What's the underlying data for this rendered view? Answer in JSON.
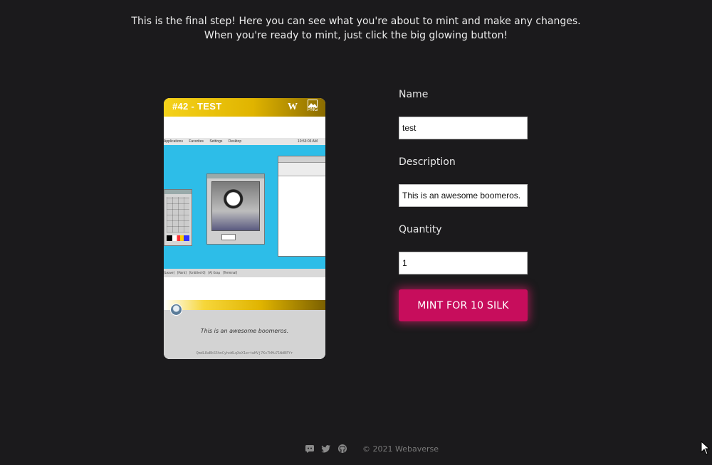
{
  "intro": {
    "line1": "This is the final step! Here you can see what you're about to mint and make any changes.",
    "line2": "When you're ready to mint, just click the big glowing button!"
  },
  "card": {
    "title": "#42 - TEST",
    "logo": "W",
    "file_type": "PNG",
    "description": "This is an awesome boomeros.",
    "hash": "QmdL8aBkS5hnCyhoWLqXeX1ertwHVj7Kx7hMu71WdBPYr",
    "screenshot": {
      "menu_items": [
        "Applications",
        "Favorites",
        "Settings",
        "Desktop"
      ],
      "clock": "10:53:03 AM",
      "taskbar_items": [
        "[Leave]",
        "[Paint]",
        "[Untitled 0]",
        "[A] Grap",
        "[Terminal]"
      ]
    }
  },
  "form": {
    "name_label": "Name",
    "name_value": "test",
    "description_label": "Description",
    "description_value": "This is an awesome boomeros.",
    "quantity_label": "Quantity",
    "quantity_value": "1",
    "mint_label": "MINT FOR 10 SILK"
  },
  "footer": {
    "copyright": "© 2021 Webaverse",
    "icons": [
      "discord-icon",
      "twitter-icon",
      "github-icon"
    ]
  },
  "colors": {
    "background": "#1b1a1c",
    "accent": "#c70d5c",
    "card_gold": "#e0b400"
  }
}
